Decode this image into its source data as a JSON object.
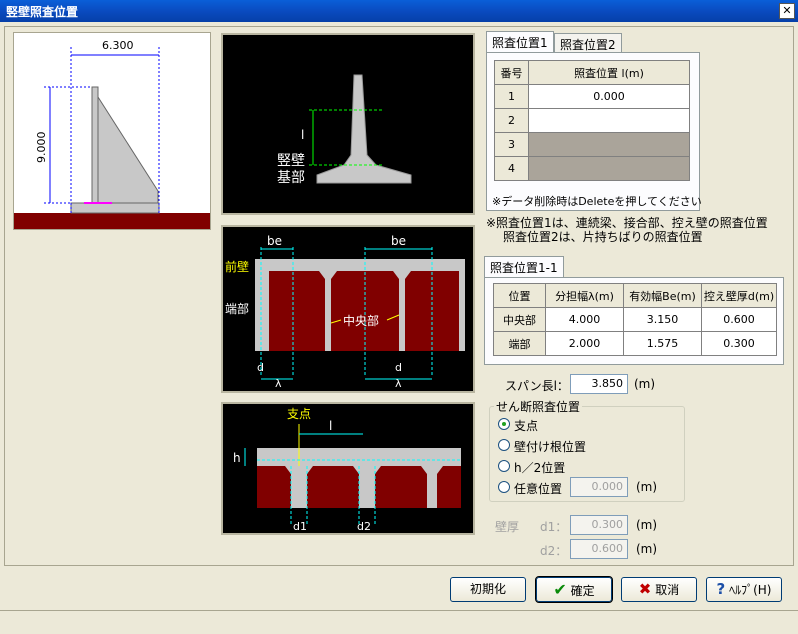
{
  "window": {
    "title": "竪壁照査位置",
    "close_glyph": "✕"
  },
  "dims": {
    "width": "6.300",
    "height": "9.000"
  },
  "diagram1": {
    "l": "l",
    "wall": "竪壁",
    "base": "基部"
  },
  "diagram2": {
    "be_left": "be",
    "be_right": "be",
    "front_wall": "前壁",
    "edge": "端部",
    "center": "中央部",
    "d_left": "d",
    "lambda_left": "λ",
    "d_right": "d",
    "lambda_right": "λ"
  },
  "diagram3": {
    "support": "支点",
    "l": "l",
    "h": "h",
    "d1": "d1",
    "d2": "d2"
  },
  "tabs_top": {
    "tab1": "照査位置1",
    "tab2": "照査位置2"
  },
  "table1": {
    "headers": [
      "番号",
      "照査位置 l(m)"
    ],
    "rows": [
      [
        "1",
        "0.000"
      ],
      [
        "2",
        ""
      ],
      [
        "3",
        ""
      ],
      [
        "4",
        ""
      ]
    ]
  },
  "note_delete": "※データ削除時はDeleteを押してください",
  "note_positions": [
    "※照査位置1は、連続梁、接合部、控え壁の照査位置",
    "照査位置2は、片持ちばりの照査位置"
  ],
  "tab_sub": "照査位置1-1",
  "table2": {
    "headers": [
      "位置",
      "分担幅λ(m)",
      "有効幅Be(m)",
      "控え壁厚d(m)"
    ],
    "rows": [
      [
        "中央部",
        "4.000",
        "3.150",
        "0.600"
      ],
      [
        "端部",
        "2.000",
        "1.575",
        "0.300"
      ]
    ]
  },
  "span": {
    "label": "スパン長l：",
    "value": "3.850",
    "unit": "(m)"
  },
  "shear": {
    "title": "せん断照査位置",
    "options": [
      "支点",
      "壁付け根位置",
      "h／2位置",
      "任意位置"
    ],
    "selected": "支点",
    "arbitrary_value": "0.000",
    "unit": "(m)"
  },
  "wall_thickness": {
    "label": "壁厚",
    "d1_label": "d1：",
    "d1_value": "0.300",
    "d2_label": "d2：",
    "d2_value": "0.600",
    "unit": "(m)"
  },
  "buttons": {
    "init": "初期化",
    "ok": "確定",
    "cancel": "取消",
    "help": "ﾍﾙﾌﾟ(H)"
  },
  "colors": {
    "title_bar": "#0a4bc0",
    "wall_fill": "#800000",
    "concrete": "#c8c8c8",
    "dim_line": "#0000ff",
    "accent_green": "#00ff00",
    "cyan": "#00ffff",
    "yellow": "#ffff00"
  }
}
